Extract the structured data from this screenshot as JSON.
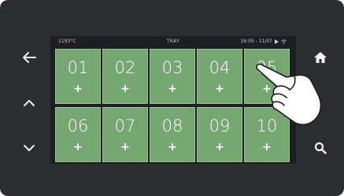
{
  "status_bar": {
    "temperature": "1193°C",
    "title": "TRAY",
    "datetime": "16:05 - 11/07",
    "play_icon": "play-icon",
    "wifi_icon": "wifi-icon"
  },
  "left_nav": {
    "back_icon": "arrow-left-icon",
    "up_icon": "chevron-up-icon",
    "down_icon": "chevron-down-icon"
  },
  "right_nav": {
    "home_icon": "home-icon",
    "search_icon": "search-icon"
  },
  "tray_slots": [
    {
      "number": "01",
      "action": "+"
    },
    {
      "number": "02",
      "action": "+"
    },
    {
      "number": "03",
      "action": "+"
    },
    {
      "number": "04",
      "action": "+"
    },
    {
      "number": "05",
      "action": "+"
    },
    {
      "number": "06",
      "action": "+"
    },
    {
      "number": "07",
      "action": "+"
    },
    {
      "number": "08",
      "action": "+"
    },
    {
      "number": "09",
      "action": "+"
    },
    {
      "number": "10",
      "action": "+"
    }
  ],
  "colors": {
    "bezel": "#2b2d31",
    "tile": "#76a672",
    "screen": "#1e1f22"
  }
}
